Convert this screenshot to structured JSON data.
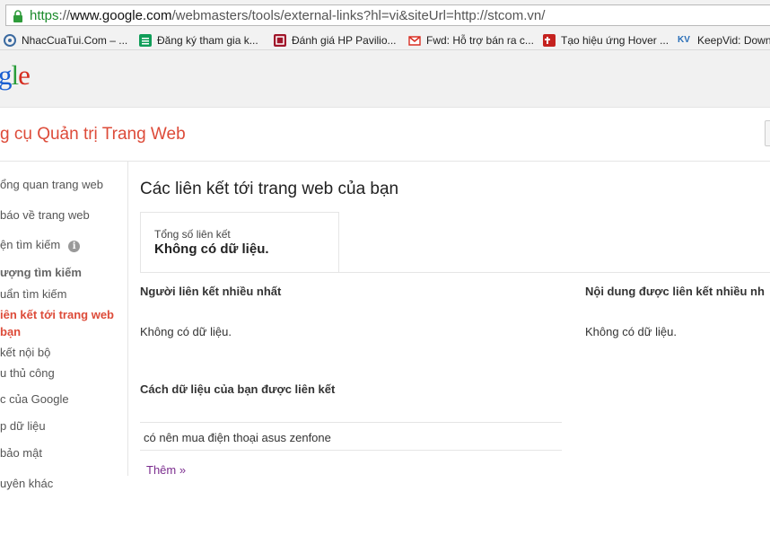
{
  "browser": {
    "url_scheme": "https",
    "url_sep": "://",
    "url_host": "www.google.com",
    "url_rest": "/webmasters/tools/external-links?hl=vi&siteUrl=http://stcom.vn/"
  },
  "bookmarks": [
    {
      "label": "NhacCuaTui.Com – ...",
      "icon": "nhaccuatui-icon",
      "color": "#3b6aa0"
    },
    {
      "label": "Đăng ký tham gia k...",
      "icon": "sheets-icon",
      "color": "#0f9d58"
    },
    {
      "label": "Đánh giá HP Pavilio...",
      "icon": "review-icon",
      "color": "#a0162a"
    },
    {
      "label": "Fwd: Hỗ trợ bán ra c...",
      "icon": "gmail-icon",
      "color": "#d93025"
    },
    {
      "label": "Tạo hiệu ứng Hover ...",
      "icon": "tao-icon",
      "color": "#c5221f"
    },
    {
      "label": "KeepVid: Downl",
      "icon": "keepvid-icon",
      "color": "#2a6fb8"
    }
  ],
  "logo": {
    "g": "g",
    "l": "l",
    "e": "e"
  },
  "wmt": {
    "title": "g cụ Quản trị Trang Web"
  },
  "sidebar": {
    "items": [
      {
        "label": "ổng quan trang web",
        "style": "normal"
      },
      {
        "label": "báo về trang web",
        "style": "normal"
      },
      {
        "label": "ện tìm kiếm",
        "style": "normal",
        "info": "i"
      },
      {
        "label": "ượng tìm kiếm",
        "style": "bold"
      },
      {
        "label": "uẩn tìm kiếm",
        "style": "normal"
      },
      {
        "label": "iên kết tới trang web",
        "style": "active"
      },
      {
        "label": "bạn",
        "style": "active"
      },
      {
        "label": "kết nội bộ",
        "style": "normal"
      },
      {
        "label": "u thủ công",
        "style": "normal"
      },
      {
        "label": "c của Google",
        "style": "normal"
      },
      {
        "label": "p dữ liệu",
        "style": "normal"
      },
      {
        "label": " bảo mật",
        "style": "normal"
      },
      {
        "label": "uyên khác",
        "style": "normal"
      }
    ]
  },
  "main": {
    "heading": "Các liên kết tới trang web của bạn",
    "total_label": "Tổng số liên kết",
    "total_value": "Không có dữ liệu.",
    "top_linkers_title": "Người liên kết nhiều nhất",
    "top_linkers_nodata": "Không có dữ liệu.",
    "top_content_title": "Nội dung được liên kết nhiều nh",
    "top_content_nodata": "Không có dữ liệu.",
    "how_linked_title": "Cách dữ liệu của bạn được liên kết",
    "how_linked_rows": [
      "có nên mua điện thoại asus zenfone"
    ],
    "more_link": "Thêm »"
  }
}
